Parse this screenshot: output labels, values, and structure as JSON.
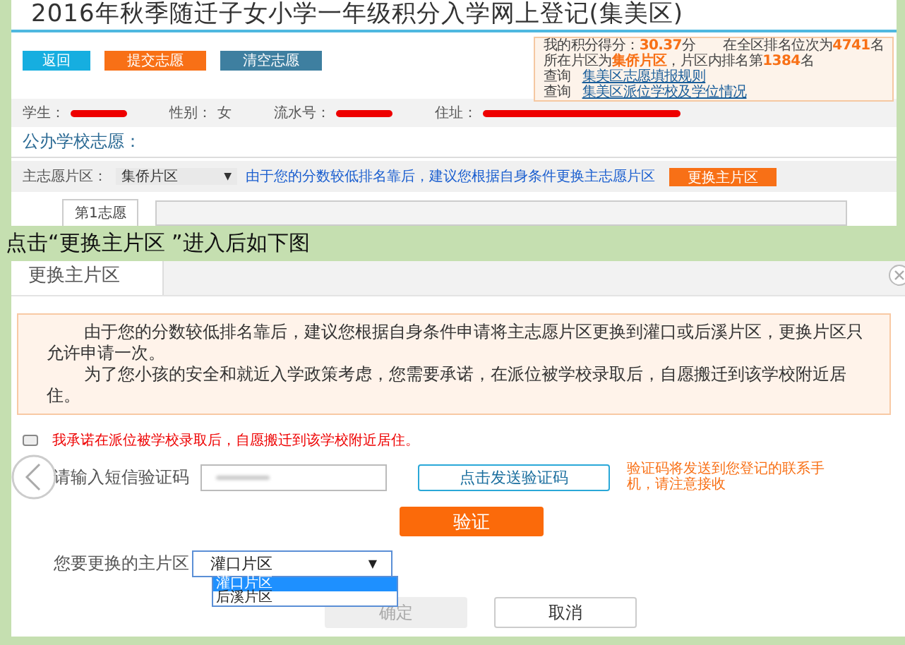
{
  "page_title": "2016年秋季随迁子女小学一年级积分入学网上登记(集美区)",
  "actions": [
    {
      "label": "返回",
      "kind": "info"
    },
    {
      "label": "提交志愿",
      "kind": "warn"
    },
    {
      "label": "清空志愿",
      "kind": "muted"
    }
  ],
  "score_box": {
    "lines": [
      [
        {
          "text": "我的积分得分：",
          "highlight": false
        },
        {
          "text": "30.37",
          "highlight": true
        },
        {
          "text": "分　　在全区排名位次为",
          "highlight": false
        },
        {
          "text": "4741",
          "highlight": true
        },
        {
          "text": "名",
          "highlight": false
        }
      ],
      [
        {
          "text": "所在片区为",
          "highlight": false
        },
        {
          "text": "集侨片区",
          "highlight": true
        },
        {
          "text": "，片区内排名第",
          "highlight": false
        },
        {
          "text": "1384",
          "highlight": true
        },
        {
          "text": "名",
          "highlight": false
        }
      ]
    ],
    "links": [
      {
        "prefix": "查询",
        "label": "集美区志愿填报规则"
      },
      {
        "prefix": "查询",
        "label": "集美区派位学校及学位情况"
      }
    ]
  },
  "student_info": [
    {
      "label": "学生：",
      "kind": "redacted_short"
    },
    {
      "label": "性别：",
      "kind": "text",
      "value": "女"
    },
    {
      "label": "流水号：",
      "kind": "redacted_short"
    },
    {
      "label": "住址：",
      "kind": "redacted_long"
    }
  ],
  "section_title": "公办学校志愿：",
  "district_row": {
    "label": "主志愿片区：",
    "select_value": "集侨片区",
    "caret": "▼",
    "notice": "由于您的分数较低排名靠后，建议您根据自身条件更换主志愿片区",
    "button": "更换主片区"
  },
  "choice_row": {
    "label": "第1志愿"
  },
  "caption": "点击“更换主片区 ”进入后如下图",
  "dialog": {
    "tab": "更换主片区",
    "notice": [
      "由于您的分数较低排名靠后，建议您根据自身条件申请将主志愿片区更换到灌口或后溪片区，更换片区只允许申请一次。",
      "为了您小孩的安全和就近入学政策考虑，您需要承诺，在派位被学校录取后，自愿搬迁到该学校附近居住。"
    ],
    "pledge": {
      "label": "我承诺在派位被学校录取后，自愿搬迁到该学校附近居住。",
      "checked": false
    },
    "sms": {
      "label": "请输入短信验证码",
      "blurred": true,
      "send_button": "点击发送验证码",
      "hint": "验证码将发送到您登记的联系手机，请注意接收"
    },
    "verify_button": "验证",
    "district_select": {
      "label": "您要更换的主片区",
      "value": "灌口片区",
      "caret": "▼",
      "expanded": true,
      "options": [
        {
          "label": "灌口片区",
          "selected": true
        },
        {
          "label": "后溪片区",
          "selected": false
        }
      ]
    },
    "confirm": {
      "label": "确定",
      "disabled": true
    },
    "cancel": {
      "label": "取消"
    }
  }
}
